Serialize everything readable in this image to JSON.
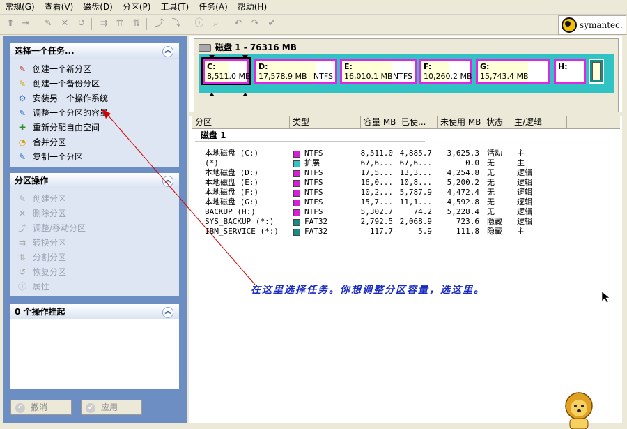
{
  "menu": [
    "常规(G)",
    "查看(V)",
    "磁盘(D)",
    "分区(P)",
    "工具(T)",
    "任务(A)",
    "帮助(H)"
  ],
  "brand": {
    "name": "symantec."
  },
  "tasks_panel": {
    "title": "选择一个任务...",
    "items": [
      {
        "label": "创建一个新分区",
        "icon": "create-partition-icon"
      },
      {
        "label": "创建一个备份分区",
        "icon": "backup-partition-icon"
      },
      {
        "label": "安装另一个操作系统",
        "icon": "install-os-icon"
      },
      {
        "label": "调整一个分区的容量",
        "icon": "resize-partition-icon"
      },
      {
        "label": "重新分配自由空间",
        "icon": "redistribute-space-icon"
      },
      {
        "label": "合并分区",
        "icon": "merge-partitions-icon"
      },
      {
        "label": "复制一个分区",
        "icon": "copy-partition-icon"
      }
    ]
  },
  "ops_panel": {
    "title": "分区操作",
    "items": [
      {
        "label": "创建分区",
        "icon": "create-icon"
      },
      {
        "label": "删除分区",
        "icon": "delete-icon"
      },
      {
        "label": "调整/移动分区",
        "icon": "resize-move-icon"
      },
      {
        "label": "转换分区",
        "icon": "convert-icon"
      },
      {
        "label": "分割分区",
        "icon": "split-icon"
      },
      {
        "label": "恢复分区",
        "icon": "undelete-icon"
      },
      {
        "label": "属性",
        "icon": "properties-icon"
      }
    ]
  },
  "pending_panel": {
    "title": "0 个操作挂起"
  },
  "buttons": {
    "undo": "撤消",
    "apply": "应用"
  },
  "disk": {
    "header": "磁盘 1 - 76316 MB",
    "partitions": [
      {
        "letter": "C:",
        "size": "8,511.0 MB",
        "fs": "",
        "used_fraction": 0.57
      },
      {
        "letter": "D:",
        "size": "17,578.9 MB",
        "fs": "NTFS",
        "used_fraction": 0.76
      },
      {
        "letter": "E:",
        "size": "16,010.1 MB",
        "fs": "NTFS",
        "used_fraction": 0.68
      },
      {
        "letter": "F:",
        "size": "10,260.2 MB",
        "fs": "",
        "used_fraction": 0.56
      },
      {
        "letter": "G:",
        "size": "15,743.4 MB",
        "fs": "",
        "used_fraction": 0.71
      },
      {
        "letter": "H:",
        "size": "",
        "fs": "",
        "used_fraction": 0.0
      }
    ]
  },
  "table": {
    "headers": [
      "分区",
      "类型",
      "容量 MB",
      "已使...",
      "未使用 MB",
      "状态",
      "主/逻辑"
    ],
    "group": "磁盘 1",
    "rows": [
      {
        "name": "本地磁盘 (C:)",
        "color": "#d81fd8",
        "type": "NTFS",
        "cap": "8,511.0",
        "used": "4,885.7",
        "free": "3,625.3",
        "status": "活动",
        "kind": "主"
      },
      {
        "name": "(*)",
        "color": "#31c2c4",
        "type": "扩展",
        "cap": "67,6...",
        "used": "67,6...",
        "free": "0.0",
        "status": "无",
        "kind": "主"
      },
      {
        "name": "本地磁盘 (D:)",
        "color": "#d81fd8",
        "type": "NTFS",
        "cap": "17,5...",
        "used": "13,3...",
        "free": "4,254.8",
        "status": "无",
        "kind": "逻辑"
      },
      {
        "name": "本地磁盘 (E:)",
        "color": "#d81fd8",
        "type": "NTFS",
        "cap": "16,0...",
        "used": "10,8...",
        "free": "5,200.2",
        "status": "无",
        "kind": "逻辑"
      },
      {
        "name": "本地磁盘 (F:)",
        "color": "#d81fd8",
        "type": "NTFS",
        "cap": "10,2...",
        "used": "5,787.9",
        "free": "4,472.4",
        "status": "无",
        "kind": "逻辑"
      },
      {
        "name": "本地磁盘 (G:)",
        "color": "#d81fd8",
        "type": "NTFS",
        "cap": "15,7...",
        "used": "11,1...",
        "free": "4,592.8",
        "status": "无",
        "kind": "逻辑"
      },
      {
        "name": "BACKUP (H:)",
        "color": "#d81fd8",
        "type": "NTFS",
        "cap": "5,302.7",
        "used": "74.2",
        "free": "5,228.4",
        "status": "无",
        "kind": "逻辑"
      },
      {
        "name": "SYS_BACKUP (*:)",
        "color": "#1a8a86",
        "type": "FAT32",
        "cap": "2,792.5",
        "used": "2,068.9",
        "free": "723.6",
        "status": "隐藏",
        "kind": "逻辑"
      },
      {
        "name": "IBM_SERVICE (*:)",
        "color": "#1a8a86",
        "type": "FAT32",
        "cap": "117.7",
        "used": "5.9",
        "free": "111.8",
        "status": "隐藏",
        "kind": "主"
      }
    ]
  },
  "annotation": "在这里选择任务。你想调整分区容量，选这里。",
  "colors": {
    "pane_blue": "#6c8ec3",
    "partition_magenta": "#e225e2",
    "extended_cyan": "#31c2c4",
    "annotation_blue": "#1a2bbf",
    "arrow_red": "#d40000"
  }
}
